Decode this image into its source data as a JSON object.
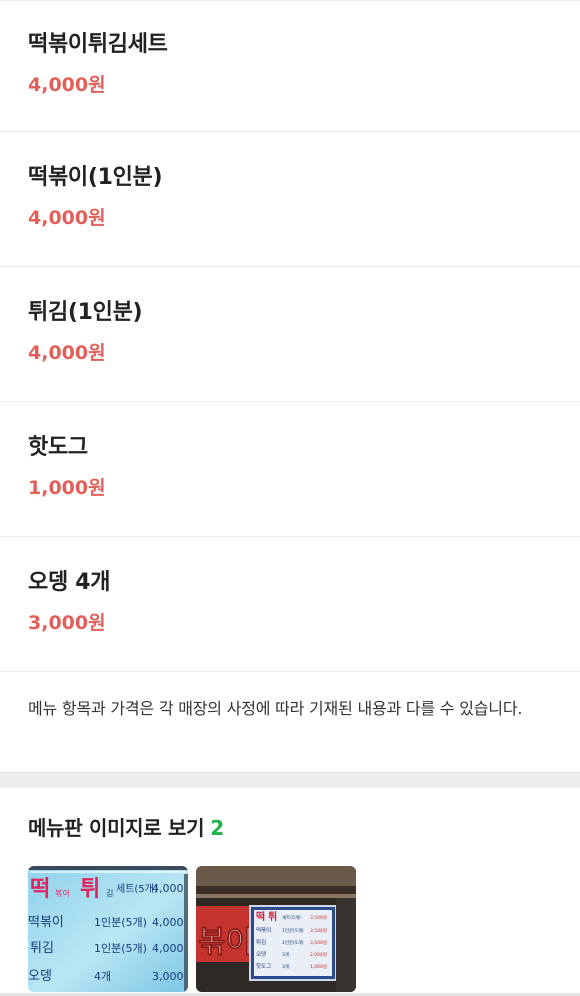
{
  "menu": {
    "items": [
      {
        "name": "떡볶이튀김세트",
        "price": "4,000원"
      },
      {
        "name": "떡볶이(1인분)",
        "price": "4,000원"
      },
      {
        "name": "튀김(1인분)",
        "price": "4,000원"
      },
      {
        "name": "핫도그",
        "price": "1,000원"
      },
      {
        "name": "오뎅 4개",
        "price": "3,000원"
      }
    ],
    "notice": "메뉴 항목과 가격은 각 매장의 사정에 따라 기재된 내용과 다를 수 있습니다."
  },
  "menu_board": {
    "title": "메뉴판 이미지로 보기",
    "count": "2",
    "colors": {
      "count": "#1db24a"
    },
    "photo_1": {
      "rows": [
        {
          "name_big": "떡",
          "name_mid": "튀",
          "name_small": "볶이",
          "name_tail": "김",
          "desc": "세트(5개)",
          "price": "4,000"
        },
        {
          "name": "떡볶이",
          "desc": "1인분(5개)",
          "price": "4,000"
        },
        {
          "name": "튀김",
          "desc": "1인분(5개)",
          "price": "4,000"
        },
        {
          "name": "오뎅",
          "desc": "4개",
          "price": "3,000"
        }
      ]
    },
    "photo_2": {
      "sign_text": "볶이",
      "board_header_big": "떡",
      "board_header_mid": "튀",
      "rows": [
        {
          "name": "떡볶이",
          "desc": "세트(5개)",
          "price": "3,500원"
        },
        {
          "name": "떡볶이",
          "desc": "1인분(5개)",
          "price": "3,500원"
        },
        {
          "name": "튀김",
          "desc": "1인분(5개)",
          "price": "3,500원"
        },
        {
          "name": "오뎅",
          "desc": "3개",
          "price": "2,000원"
        },
        {
          "name": "핫도그",
          "desc": "3개",
          "price": "1,000원"
        }
      ]
    }
  },
  "colors": {
    "price": "#e35f5a",
    "accent_green": "#1db24a"
  }
}
